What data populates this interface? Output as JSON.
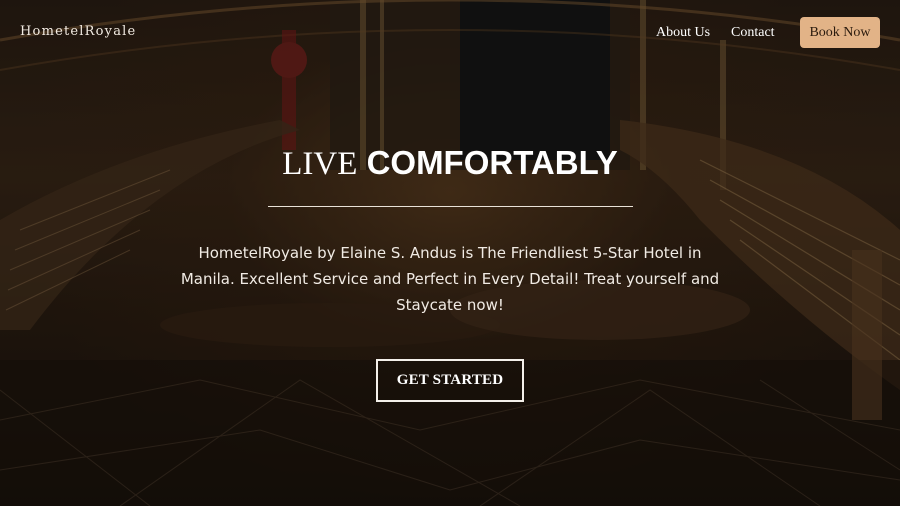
{
  "brand": {
    "name": "HometelRoyale"
  },
  "nav": {
    "about_label": "About Us",
    "contact_label": "Contact",
    "book_label": "Book Now"
  },
  "hero": {
    "title_part1": "LIVE",
    "title_part2": "COMFORTABLY",
    "description": "HometelRoyale by Elaine S. Andus is The Friendliest 5-Star Hotel in Manila. Excellent Service and Perfect in Every Detail! Treat yourself and Staycate now!",
    "cta_label": "GET STARTED"
  },
  "colors": {
    "accent": "#e2b387",
    "text": "#ffffff",
    "overlay": "#1c140d"
  }
}
